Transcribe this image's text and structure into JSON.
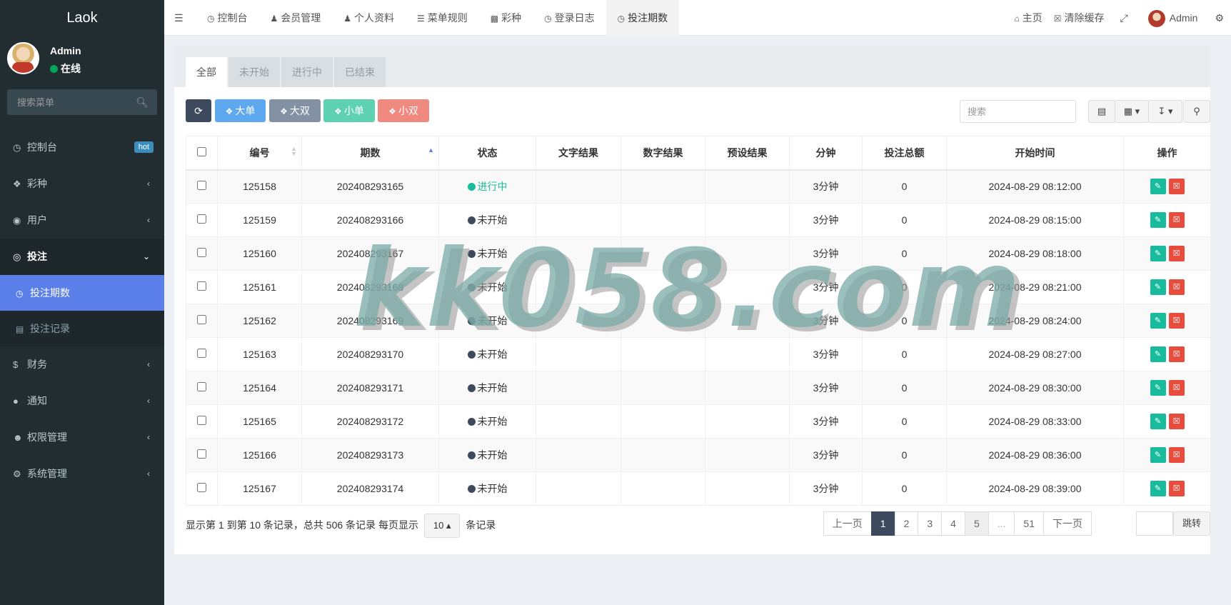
{
  "app": {
    "logo": "Laok"
  },
  "user": {
    "name": "Admin",
    "status": "在线"
  },
  "sidebar": {
    "search_placeholder": "搜索菜单",
    "items": [
      {
        "label": "控制台",
        "icon": "dashboard-icon",
        "badge": "hot"
      },
      {
        "label": "彩种",
        "icon": "cube-icon"
      },
      {
        "label": "用户",
        "icon": "user-circle-icon"
      },
      {
        "label": "投注",
        "icon": "eye-icon",
        "expanded": true
      },
      {
        "label": "财务",
        "icon": "dollar-icon"
      },
      {
        "label": "通知",
        "icon": "comment-icon"
      },
      {
        "label": "权限管理",
        "icon": "users-icon"
      },
      {
        "label": "系统管理",
        "icon": "cogs-icon"
      }
    ],
    "submenu": [
      {
        "label": "投注期数",
        "icon": "clock-icon"
      },
      {
        "label": "投注记录",
        "icon": "list-icon"
      }
    ]
  },
  "navbar": {
    "tabs": [
      {
        "label": "控制台",
        "icon": "dashboard-icon"
      },
      {
        "label": "会员管理",
        "icon": "user-icon"
      },
      {
        "label": "个人资料",
        "icon": "user-icon"
      },
      {
        "label": "菜单规则",
        "icon": "bars-icon"
      },
      {
        "label": "彩种",
        "icon": "cube-icon"
      },
      {
        "label": "登录日志",
        "icon": "clock-icon"
      },
      {
        "label": "投注期数",
        "icon": "clock-icon"
      }
    ],
    "right": {
      "home": "主页",
      "clear_cache": "清除缓存",
      "user": "Admin"
    }
  },
  "filter_tabs": [
    "全部",
    "未开始",
    "进行中",
    "已结束"
  ],
  "toolbar": {
    "buttons": [
      "大单",
      "大双",
      "小单",
      "小双"
    ],
    "colors": {
      "refresh": "#3d4a5d",
      "big_single": "#5ea8f0",
      "big_double": "#8391a5",
      "small_single": "#5fd1b3",
      "small_double": "#f08a80"
    },
    "search_placeholder": "搜索"
  },
  "table": {
    "columns": [
      "编号",
      "期数",
      "状态",
      "文字结果",
      "数字结果",
      "预设结果",
      "分钟",
      "投注总额",
      "开始时间",
      "操作"
    ],
    "rows": [
      {
        "id": "125158",
        "period": "202408293165",
        "status": "进行中",
        "minutes": "3分钟",
        "total": "0",
        "start": "2024-08-29 08:12:00"
      },
      {
        "id": "125159",
        "period": "202408293166",
        "status": "未开始",
        "minutes": "3分钟",
        "total": "0",
        "start": "2024-08-29 08:15:00"
      },
      {
        "id": "125160",
        "period": "202408293167",
        "status": "未开始",
        "minutes": "3分钟",
        "total": "0",
        "start": "2024-08-29 08:18:00"
      },
      {
        "id": "125161",
        "period": "202408293168",
        "status": "未开始",
        "minutes": "3分钟",
        "total": "0",
        "start": "2024-08-29 08:21:00"
      },
      {
        "id": "125162",
        "period": "202408293169",
        "status": "未开始",
        "minutes": "3分钟",
        "total": "0",
        "start": "2024-08-29 08:24:00"
      },
      {
        "id": "125163",
        "period": "202408293170",
        "status": "未开始",
        "minutes": "3分钟",
        "total": "0",
        "start": "2024-08-29 08:27:00"
      },
      {
        "id": "125164",
        "period": "202408293171",
        "status": "未开始",
        "minutes": "3分钟",
        "total": "0",
        "start": "2024-08-29 08:30:00"
      },
      {
        "id": "125165",
        "period": "202408293172",
        "status": "未开始",
        "minutes": "3分钟",
        "total": "0",
        "start": "2024-08-29 08:33:00"
      },
      {
        "id": "125166",
        "period": "202408293173",
        "status": "未开始",
        "minutes": "3分钟",
        "total": "0",
        "start": "2024-08-29 08:36:00"
      },
      {
        "id": "125167",
        "period": "202408293174",
        "status": "未开始",
        "minutes": "3分钟",
        "total": "0",
        "start": "2024-08-29 08:39:00"
      }
    ]
  },
  "pagination": {
    "info_prefix": "显示第 1 到第 10 条记录，总共 506 条记录 每页显示",
    "page_size": "10",
    "info_suffix": "条记录",
    "prev": "上一页",
    "pages": [
      "1",
      "2",
      "3",
      "4",
      "5",
      "...",
      "51"
    ],
    "next": "下一页",
    "jump": "跳转"
  },
  "watermark": "kk058.com"
}
